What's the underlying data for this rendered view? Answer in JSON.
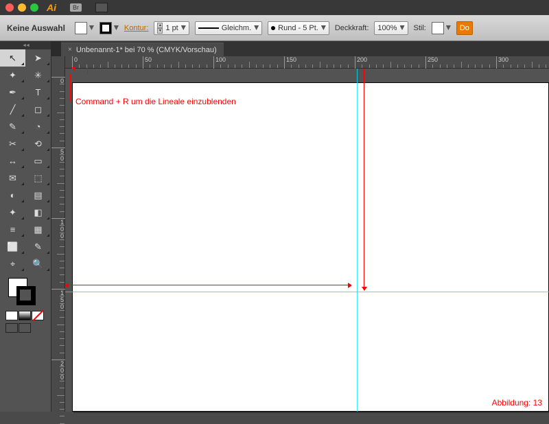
{
  "titlebar": {
    "app": "Ai",
    "bridge": "Br"
  },
  "options": {
    "no_selection": "Keine Auswahl",
    "kontur_label": "Kontur:",
    "stroke_weight": "1 pt",
    "dash_label": "Gleichm.",
    "brush_label": "Rund - 5 Pt.",
    "opacity_label": "Deckkraft:",
    "opacity_value": "100%",
    "style_label": "Stil:",
    "doc_setup": "Do"
  },
  "document": {
    "tab_title": "Unbenannt-1* bei 70 % (CMYK/Vorschau)"
  },
  "rulers": {
    "h_ticks": [
      "0",
      "50",
      "100",
      "150",
      "200",
      "250",
      "300"
    ],
    "v_ticks": [
      "0",
      "50",
      "100",
      "150",
      "200"
    ]
  },
  "tools": [
    "↖",
    "➤",
    "✦",
    "✳",
    "✒",
    "T",
    "╱",
    "◻",
    "✎",
    "◔",
    "✂",
    "⟲",
    "↔",
    "▭",
    "✉",
    "⬚",
    "◐",
    "▤",
    "✦",
    "◧",
    "≡",
    "▦",
    "⬜",
    "✎",
    "⌖",
    "🔍"
  ],
  "annotations": {
    "line1": "Command + R um die Lineale einzublenden",
    "caption": "Abbildung: 13"
  }
}
